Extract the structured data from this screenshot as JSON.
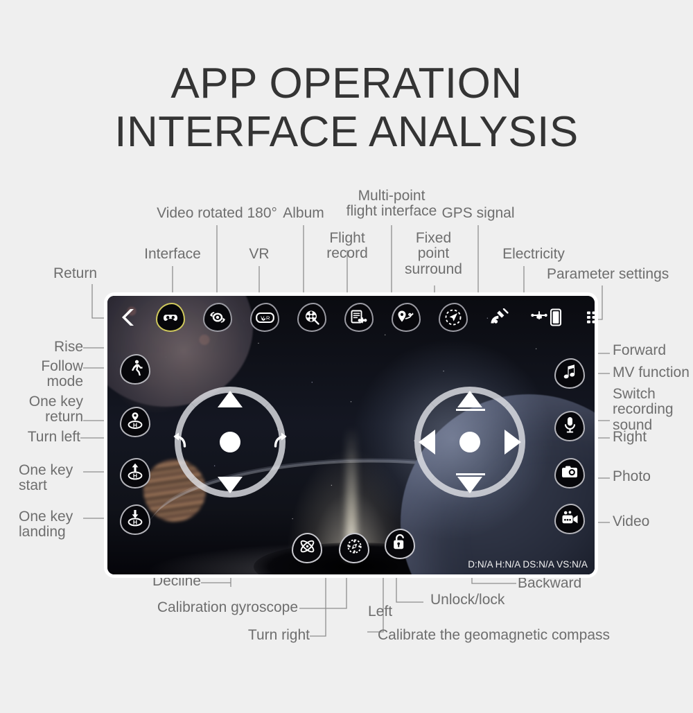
{
  "title": "APP OPERATION\nINTERFACE ANALYSIS",
  "panel": {
    "telemetry": "D:N/A H:N/A DS:N/A VS:N/A",
    "toolbar": [
      {
        "name": "return",
        "icon": "chevron-left-icon",
        "label": "Return",
        "selected": false
      },
      {
        "name": "interface",
        "icon": "gamepad-icon",
        "label": "Interface",
        "selected": true
      },
      {
        "name": "video-rotate",
        "icon": "video-rotate-180-icon",
        "label": "Video rotated 180°",
        "selected": false
      },
      {
        "name": "vr",
        "icon": "vr-goggles-icon",
        "label": "VR",
        "selected": false
      },
      {
        "name": "album",
        "icon": "film-search-icon",
        "label": "Album",
        "selected": false
      },
      {
        "name": "flight-record",
        "icon": "flight-record-icon",
        "label": "Flight\nrecord",
        "selected": false
      },
      {
        "name": "multi-point",
        "icon": "waypoint-path-icon",
        "label": "Multi-point\nflight interface",
        "selected": false
      },
      {
        "name": "fixed-point",
        "icon": "orbit-surround-icon",
        "label": "Fixed\npoint\nsurround",
        "selected": false
      },
      {
        "name": "gps-signal",
        "icon": "satellite-icon",
        "label": "GPS signal",
        "selected": false
      },
      {
        "name": "electricity",
        "icon": "drone-battery-icon",
        "label": "Electricity",
        "selected": false
      },
      {
        "name": "parameters",
        "icon": "list-settings-icon",
        "label": "Parameter settings",
        "selected": false
      }
    ],
    "left_buttons": [
      {
        "name": "follow-mode",
        "icon": "walking-person-icon",
        "label": "Follow\nmode"
      },
      {
        "name": "one-key-return",
        "icon": "return-home-icon",
        "label": "One key\nreturn"
      },
      {
        "name": "one-key-start",
        "icon": "takeoff-home-icon",
        "label": "One key\nstart"
      },
      {
        "name": "one-key-landing",
        "icon": "landing-home-icon",
        "label": "One key\nlanding"
      }
    ],
    "right_buttons": [
      {
        "name": "mv-function",
        "icon": "music-note-icon",
        "label": "MV function"
      },
      {
        "name": "switch-recording",
        "icon": "microphone-icon",
        "label": "Switch\nrecording\nsound"
      },
      {
        "name": "photo",
        "icon": "camera-icon",
        "label": "Photo"
      },
      {
        "name": "video",
        "icon": "video-camera-icon",
        "label": "Video"
      }
    ],
    "bottom_buttons": [
      {
        "name": "calibration-gyroscope",
        "icon": "gyroscope-icon",
        "label": "Calibration gyroscope"
      },
      {
        "name": "geomagnetic-compass",
        "icon": "compass-icon",
        "label": "Calibrate the geomagnetic compass"
      },
      {
        "name": "unlock-lock",
        "icon": "padlock-open-icon",
        "label": "Unlock/lock"
      }
    ],
    "left_joystick": {
      "up": "Rise",
      "down": "Decline",
      "left": "Turn left",
      "right": "Turn right"
    },
    "right_joystick": {
      "up": "Forward",
      "down": "Backward",
      "left": "Left",
      "right": "Right"
    }
  },
  "colors": {
    "page_bg": "#efefef",
    "label_text": "#6e6e6e",
    "title_text": "#343434",
    "leader_line": "#8d8d8d",
    "selected_ring": "#cfc85c",
    "panel_border": "#ffffff"
  }
}
